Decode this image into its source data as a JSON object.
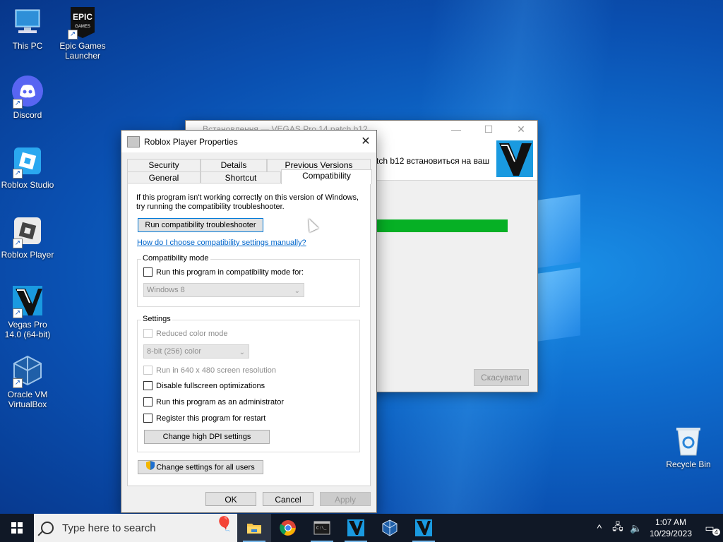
{
  "desktop": {
    "icons": [
      {
        "label": "This PC",
        "icon": "this-pc-icon"
      },
      {
        "label": "Epic Games Launcher",
        "icon": "epic-games-icon"
      },
      {
        "label": "Discord",
        "icon": "discord-icon"
      },
      {
        "label": "Roblox Studio",
        "icon": "roblox-studio-icon"
      },
      {
        "label": "Roblox Player",
        "icon": "roblox-player-icon"
      },
      {
        "label": "Vegas Pro 14.0 (64-bit)",
        "icon": "vegas-pro-icon"
      },
      {
        "label": "Oracle VM VirtualBox",
        "icon": "virtualbox-icon"
      },
      {
        "label": "Recycle Bin",
        "icon": "recycle-bin-icon"
      }
    ]
  },
  "vegas_window": {
    "title": "Встановлення — VEGAS Pro 14 patch b12",
    "message": "tch b12 встановиться на ваш",
    "progress": 1.0,
    "cancel_label": "Скасувати"
  },
  "dialog": {
    "title": "Roblox Player Properties",
    "tabs_top": [
      "Security",
      "Details",
      "Previous Versions"
    ],
    "tabs_bottom": [
      "General",
      "Shortcut",
      "Compatibility"
    ],
    "active_tab": "Compatibility",
    "intro_line1": "If this program isn't working correctly on this version of Windows,",
    "intro_line2": "try running the compatibility troubleshooter.",
    "troubleshooter_label": "Run compatibility troubleshooter",
    "manual_link": "How do I choose compatibility settings manually?",
    "compat_mode": {
      "group_label": "Compatibility mode",
      "checkbox_label": "Run this program in compatibility mode for:",
      "selected_os": "Windows 8"
    },
    "settings": {
      "group_label": "Settings",
      "reduced_color": "Reduced color mode",
      "color_value": "8-bit (256) color",
      "resolution": "Run in 640 x 480 screen resolution",
      "disable_fullscreen": "Disable fullscreen optimizations",
      "run_admin": "Run this program as an administrator",
      "register_restart": "Register this program for restart",
      "dpi_button": "Change high DPI settings"
    },
    "all_users_button": "Change settings for all users",
    "ok": "OK",
    "cancel": "Cancel",
    "apply": "Apply"
  },
  "taskbar": {
    "search_placeholder": "Type here to search",
    "apps": [
      "file-explorer-icon",
      "chrome-icon",
      "terminal-icon",
      "vegas-pro-icon",
      "virtualbox-icon",
      "vegas-pro-icon"
    ],
    "time": "1:07 AM",
    "date": "10/29/2023",
    "notification_count": "4"
  }
}
